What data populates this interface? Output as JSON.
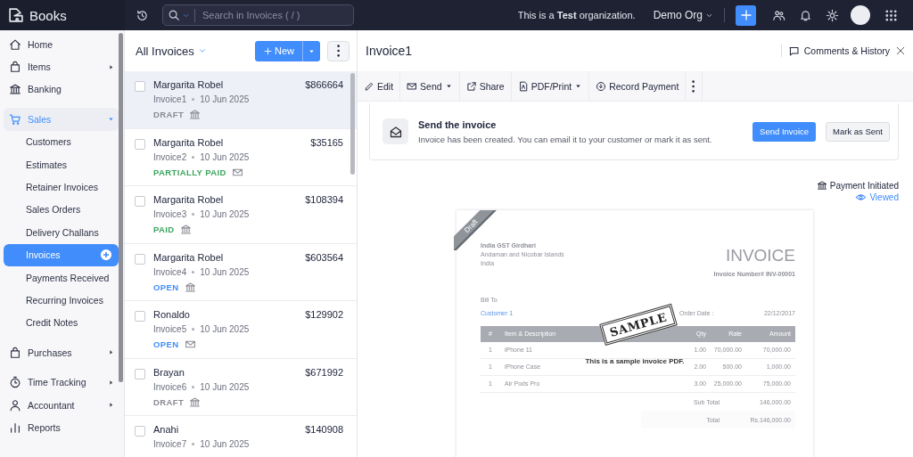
{
  "app": {
    "name": "Books"
  },
  "search": {
    "placeholder": "Search in Invoices ( / )"
  },
  "org": {
    "notice": "This is a **Test** organization.",
    "name": "Demo Org"
  },
  "sidebar": {
    "sections": [
      {
        "items": [
          {
            "label": "Home"
          },
          {
            "label": "Items",
            "expanded": false
          },
          {
            "label": "Banking"
          }
        ]
      },
      {
        "items": [
          {
            "label": "Sales",
            "expanded": true,
            "children": [
              {
                "label": "Customers",
                "selected": false
              },
              {
                "label": "Estimates",
                "selected": false
              },
              {
                "label": "Retainer Invoices",
                "selected": false
              },
              {
                "label": "Sales Orders",
                "selected": false
              },
              {
                "label": "Delivery Challans",
                "selected": false
              },
              {
                "label": "Invoices",
                "selected": true
              },
              {
                "label": "Payments Received",
                "selected": false
              },
              {
                "label": "Recurring Invoices",
                "selected": false
              },
              {
                "label": "Credit Notes",
                "selected": false
              }
            ]
          }
        ]
      },
      {
        "items": [
          {
            "label": "Purchases",
            "expanded": false
          }
        ]
      },
      {
        "items": [
          {
            "label": "Time Tracking",
            "expanded": false
          },
          {
            "label": "Accountant",
            "expanded": false
          },
          {
            "label": "Reports"
          }
        ]
      }
    ]
  },
  "list": {
    "title": "All Invoices",
    "new_button": "New",
    "rows": [
      {
        "name": "Margarita Robel",
        "amount": "$866664",
        "invoice": "Invoice1",
        "date": "10 Jun 2025",
        "status": "DRAFT",
        "color": "#8a8a94",
        "kind": "bank",
        "checked": false,
        "selected": true
      },
      {
        "name": "Margarita Robel",
        "amount": "$35165",
        "invoice": "Invoice2",
        "date": "10 Jun 2025",
        "status": "PARTIALLY PAID",
        "color": "#3aa55d",
        "kind": "mail",
        "checked": false,
        "selected": false
      },
      {
        "name": "Margarita Robel",
        "amount": "$108394",
        "invoice": "Invoice3",
        "date": "10 Jun 2025",
        "status": "PAID",
        "color": "#3aa55d",
        "kind": "bank",
        "checked": false,
        "selected": false
      },
      {
        "name": "Margarita Robel",
        "amount": "$603564",
        "invoice": "Invoice4",
        "date": "10 Jun 2025",
        "status": "OPEN",
        "color": "#408dfb",
        "kind": "bank",
        "checked": false,
        "selected": false
      },
      {
        "name": "Ronaldo",
        "amount": "$129902",
        "invoice": "Invoice5",
        "date": "10 Jun 2025",
        "status": "OPEN",
        "color": "#408dfb",
        "kind": "mail",
        "checked": false,
        "selected": false
      },
      {
        "name": "Brayan",
        "amount": "$671992",
        "invoice": "Invoice6",
        "date": "10 Jun 2025",
        "status": "DRAFT",
        "color": "#8a8a94",
        "kind": "bank",
        "checked": false,
        "selected": false
      },
      {
        "name": "Anahi",
        "amount": "$140908",
        "invoice": "Invoice7",
        "date": "10 Jun 2025",
        "checked": false,
        "selected": false
      }
    ]
  },
  "detail": {
    "title": "Invoice1",
    "comments": "Comments & History",
    "toolbar": [
      {
        "label": "Edit",
        "dropdown": false
      },
      {
        "label": "Send",
        "dropdown": true
      },
      {
        "label": "Share",
        "dropdown": false
      },
      {
        "label": "PDF/Print",
        "dropdown": true
      },
      {
        "label": "Record Payment",
        "dropdown": false
      }
    ],
    "banner": {
      "title": "Send the invoice",
      "text": "Invoice has been created. You can email it to your customer or mark it as sent.",
      "primary": "Send Invoice",
      "secondary": "Mark as Sent"
    },
    "payment_status": "Payment Initiated",
    "view_status": "Viewed",
    "document": {
      "ribbon": "Draft",
      "from": [
        "India GST Girdhari",
        "Andaman and Nicobar Islands",
        "India"
      ],
      "heading": "INVOICE",
      "number": "Invoice Number# INV-00001",
      "bill_to": "Bill To",
      "customer": "Customer 1",
      "order_date_label": "Order Date :",
      "order_date": "22/12/2017",
      "columns": [
        "#",
        "Item & Description",
        "Qty",
        "Rate",
        "Amount"
      ],
      "rows": [
        [
          "1",
          "iPhone 11",
          "1.00",
          "70,000.00",
          "70,000.00"
        ],
        [
          "1",
          "iPhone Case",
          "2.00",
          "500.00",
          "1,000.00"
        ],
        [
          "1",
          "Air Pods Pro",
          "3.00",
          "25,000.00",
          "75,000.00"
        ]
      ],
      "totals": [
        {
          "label": "Sub Total",
          "value": "146,000.00"
        },
        {
          "label": "Total",
          "value": "Rs.146,000.00"
        }
      ],
      "stamp": "SAMPLE",
      "note": "This is a sample invoice PDF."
    }
  }
}
